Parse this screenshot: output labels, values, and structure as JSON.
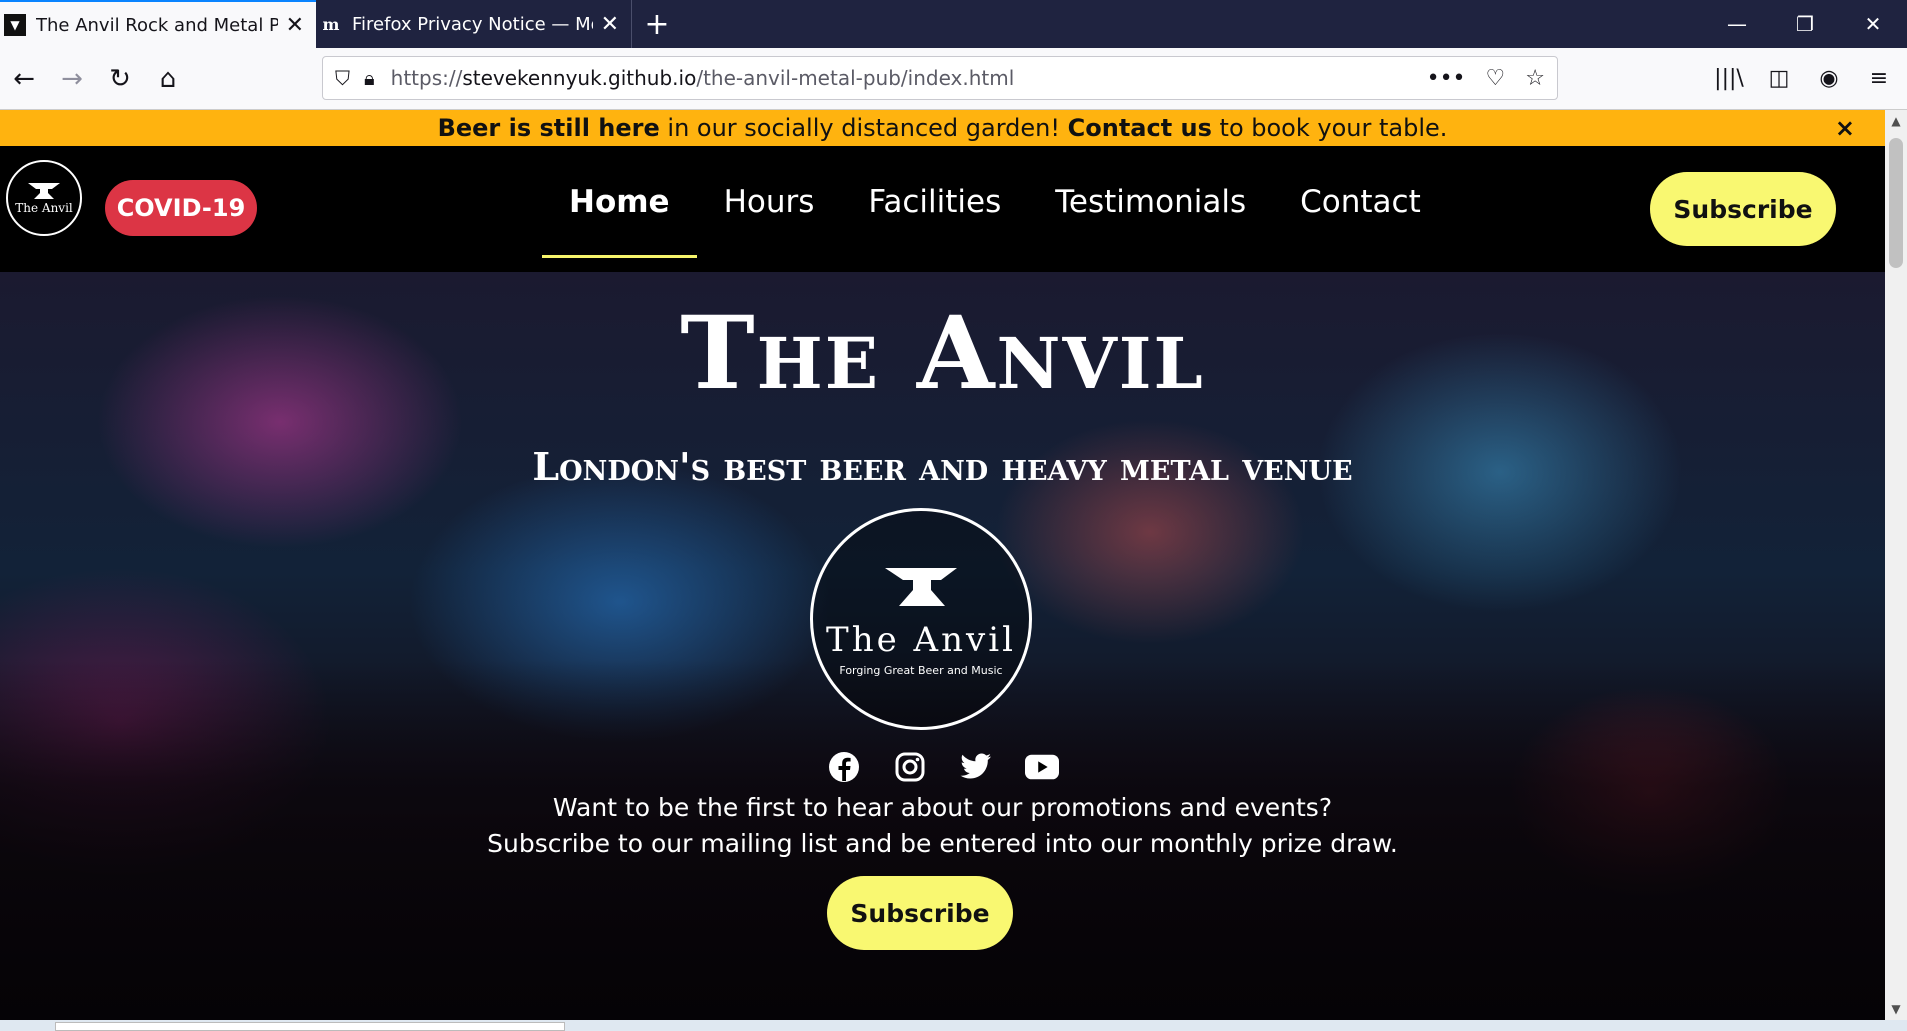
{
  "browser": {
    "tabs": [
      {
        "title": "The Anvil Rock and Metal Pub",
        "active": true,
        "favicon": "anvil-icon"
      },
      {
        "title": "Firefox Privacy Notice — Mozill",
        "active": false,
        "favicon": "m"
      }
    ],
    "url_prefix": "https://",
    "url_domain": "stevekennyuk.github.io",
    "url_path": "/the-anvil-metal-pub/index.html"
  },
  "banner": {
    "bold1": "Beer is still here",
    "text1": " in our socially distanced garden! ",
    "bold2": "Contact us",
    "text2": " to book your table.",
    "close": "×"
  },
  "header": {
    "logo_text": "The Anvil",
    "covid_label": "COVID-19",
    "menu": [
      "Home",
      "Hours",
      "Facilities",
      "Testimonials",
      "Contact"
    ],
    "subscribe_label": "Subscribe"
  },
  "hero": {
    "title": "The Anvil",
    "subtitle": "London's best beer and heavy metal venue",
    "logo_name": "The Anvil",
    "logo_tagline": "Forging Great Beer and Music",
    "line1": "Want to be the first to hear about our promotions and events?",
    "line2": "Subscribe to our mailing list and be entered into our monthly prize draw.",
    "subscribe_label": "Subscribe",
    "socials": [
      "facebook-icon",
      "instagram-icon",
      "twitter-icon",
      "youtube-icon"
    ]
  },
  "colors": {
    "banner": "#ffb30f",
    "covid": "#dc3545",
    "subscribe": "#f9f871",
    "tabbar": "#1f2340"
  }
}
